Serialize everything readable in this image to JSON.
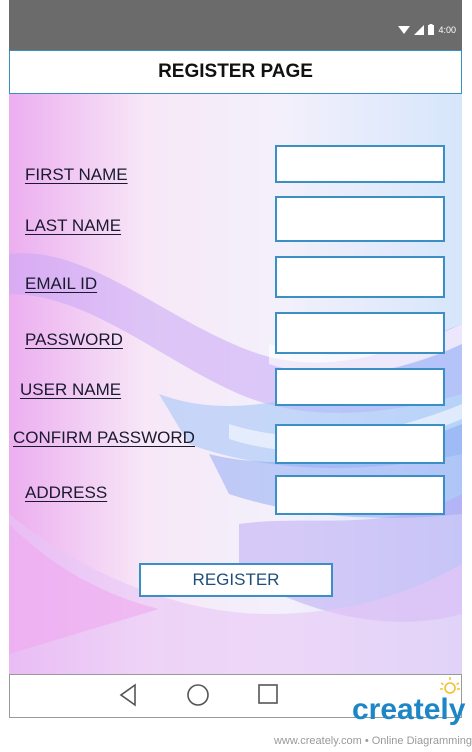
{
  "status_bar": {
    "time": "4:00"
  },
  "title": "REGISTER PAGE",
  "form": {
    "fields": [
      {
        "label": "FIRST NAME"
      },
      {
        "label": "LAST NAME"
      },
      {
        "label": "EMAIL ID"
      },
      {
        "label": "PASSWORD"
      },
      {
        "label": "USER NAME"
      },
      {
        "label": "CONFIRM PASSWORD"
      },
      {
        "label": "ADDRESS"
      }
    ],
    "submit_label": "REGISTER"
  },
  "nav": {
    "back_icon": "back-triangle-icon",
    "home_icon": "home-circle-icon",
    "recents_icon": "recents-square-icon"
  },
  "watermark": {
    "brand": "creately",
    "tagline": "www.creately.com • Online Diagramming"
  },
  "colors": {
    "accent": "#3a90c4",
    "status_bar": "#6b6b6b",
    "brand": "#1d86c6"
  }
}
